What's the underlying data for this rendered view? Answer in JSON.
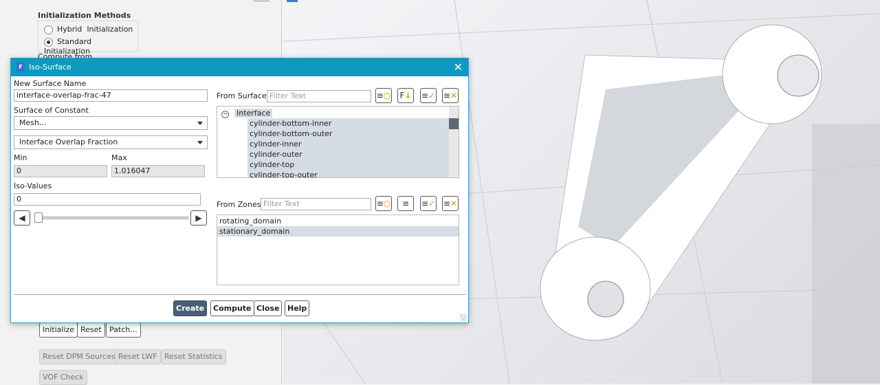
{
  "left_panel": {
    "init_methods_title": "Initialization Methods",
    "hybrid_label": "Hybrid  Initialization",
    "standard_label": "Standard Initialization",
    "selected_method": "standard",
    "compute_from_label": "Compute from",
    "buttons": {
      "initialize": "Initialize",
      "reset": "Reset",
      "patch": "Patch...",
      "reset_dpm": "Reset DPM Sources",
      "reset_lwf": "Reset LWF",
      "reset_stats": "Reset Statistics",
      "vof_check": "VOF Check"
    }
  },
  "dialog": {
    "title": "Iso-Surface",
    "new_surface_name_label": "New Surface Name",
    "new_surface_name": "interface-overlap-frac-47",
    "surface_of_constant_label": "Surface of Constant",
    "constant_category": "Mesh...",
    "constant_field": "Interface Overlap Fraction",
    "min_label": "Min",
    "max_label": "Max",
    "min_value": "0",
    "max_value": "1.016047",
    "iso_values_label": "Iso-Values",
    "iso_value": "0",
    "slider_fraction": 0,
    "from_surface_label": "From Surface",
    "from_zones_label": "From Zones",
    "filter_placeholder": "Filter Text",
    "surface_group": "Interface",
    "surfaces": [
      "cylinder-bottom-inner",
      "cylinder-bottom-outer",
      "cylinder-inner",
      "cylinder-outer",
      "cylinder-top",
      "cylinder-top-outer"
    ],
    "zones": [
      "rotating_domain",
      "stationary_domain"
    ],
    "selected_zone": "stationary_domain",
    "buttons": {
      "create": "Create",
      "compute": "Compute",
      "close": "Close",
      "help": "Help"
    }
  },
  "colors": {
    "titlebar": "#0b9bbf",
    "primary_button": "#4a5f75",
    "selection": "#d5dce4"
  }
}
